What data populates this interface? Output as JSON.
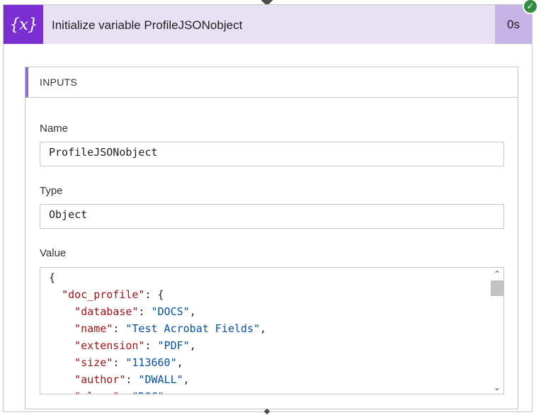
{
  "action": {
    "icon_glyph": "{x}",
    "title": "Initialize variable ProfileJSONobject",
    "duration": "0s",
    "status_icon": "check-icon",
    "status_glyph": "✓"
  },
  "inputs": {
    "section_title": "INPUTS",
    "name_label": "Name",
    "name_value": "ProfileJSONobject",
    "type_label": "Type",
    "type_value": "Object",
    "value_label": "Value",
    "value_lines": [
      {
        "indent": "",
        "key": "",
        "sep": "{",
        "val": "",
        "tail": ""
      },
      {
        "indent": "  ",
        "key": "\"doc_profile\"",
        "sep": ": {",
        "val": "",
        "tail": ""
      },
      {
        "indent": "    ",
        "key": "\"database\"",
        "sep": ": ",
        "val": "\"DOCS\"",
        "tail": ","
      },
      {
        "indent": "    ",
        "key": "\"name\"",
        "sep": ": ",
        "val": "\"Test Acrobat Fields\"",
        "tail": ","
      },
      {
        "indent": "    ",
        "key": "\"extension\"",
        "sep": ": ",
        "val": "\"PDF\"",
        "tail": ","
      },
      {
        "indent": "    ",
        "key": "\"size\"",
        "sep": ": ",
        "val": "\"113660\"",
        "tail": ","
      },
      {
        "indent": "    ",
        "key": "\"author\"",
        "sep": ": ",
        "val": "\"DWALL\"",
        "tail": ","
      },
      {
        "indent": "    ",
        "key": "\"class\"",
        "sep": ": ",
        "val": "\"DOC\"",
        "tail": ","
      }
    ]
  },
  "scroll": {
    "up_glyph": "⌃",
    "down_glyph": "⌄"
  }
}
